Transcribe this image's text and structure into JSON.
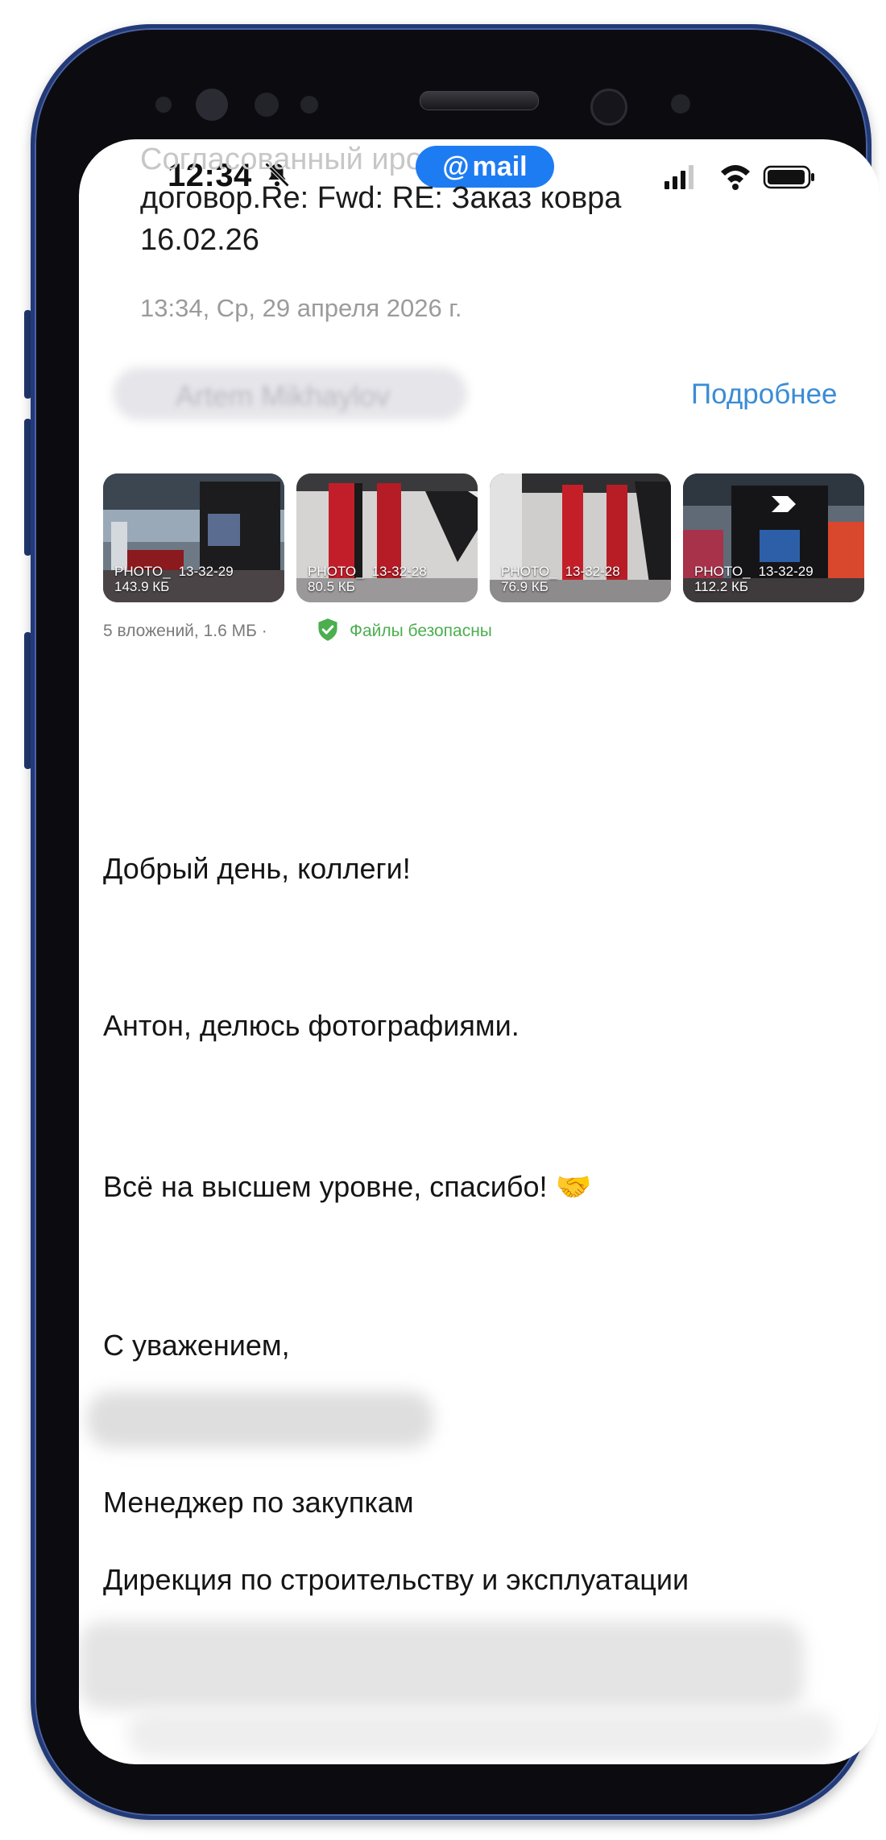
{
  "status_bar": {
    "time": "12:34",
    "mail_badge": "mail",
    "icons": [
      "bell-off-icon",
      "signal-icon",
      "wifi-icon",
      "battery-icon"
    ]
  },
  "message": {
    "subject_faded": "С⁠огласованный ирова…",
    "subject_line2": "договор.Re: Fwd: RE: Заказ ковра",
    "subject_line3": "16.02.26",
    "date": "13:34, Ср, 29 апреля 2026 г.",
    "sender": "Artem Mikhaylov",
    "details_link": "Подробнее"
  },
  "attachments": {
    "items": [
      {
        "name": "PHOTO_",
        "time": "13-32-29",
        "size": "143.9 КБ"
      },
      {
        "name": "PHOTO_",
        "time": "13-32-28",
        "size": "80.5 КБ"
      },
      {
        "name": "PHOTO_",
        "time": "13-32-28",
        "size": "76.9 КБ"
      },
      {
        "name": "PHOTO_",
        "time": "13-32-29",
        "size": "112.2 КБ"
      }
    ],
    "summary": "5 вложений, 1.6 МБ ·",
    "safety": "Файлы безопасны"
  },
  "body": {
    "greeting": "Добрый день, коллеги!",
    "line1": "Антон, делюсь фотографиями.",
    "line2": "Всё на высшем уровне, спасибо! 🤝",
    "closing": "С уважением,",
    "position": "Менеджер по закупкам",
    "department": "Дирекция по строительству и эксплуатации"
  },
  "colors": {
    "accent": "#1e7cf2",
    "link": "#3a8cd6",
    "safe_green": "#4cae4f",
    "frame_blue": "#233a78"
  }
}
